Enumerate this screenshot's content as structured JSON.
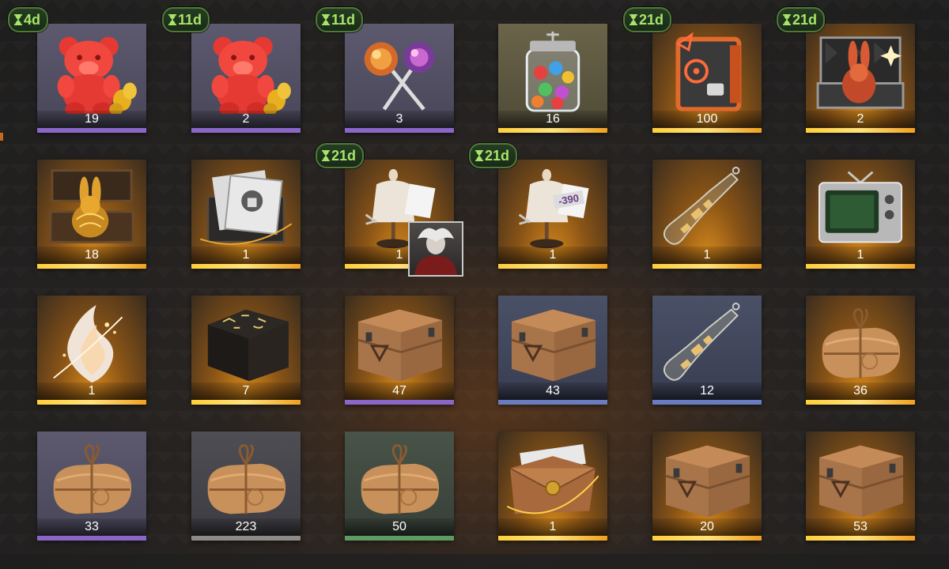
{
  "colors": {
    "rarity_purple": "#8a66c8",
    "rarity_gold": "#ffd24a",
    "rarity_blue": "#6a7cc0",
    "rarity_green": "#5f9a62",
    "rarity_grey": "#8e8b86",
    "timer_text": "#a6e56a"
  },
  "inventory": {
    "items": [
      {
        "icon": "red-gummy-bear-icon",
        "quantity": "19",
        "timer": "4d",
        "rarity": "purple"
      },
      {
        "icon": "red-gummy-bear-icon",
        "quantity": "2",
        "timer": "11d",
        "rarity": "purple"
      },
      {
        "icon": "lollipops-icon",
        "quantity": "3",
        "timer": "11d",
        "rarity": "purple"
      },
      {
        "icon": "candy-jar-icon",
        "quantity": "16",
        "timer": "",
        "rarity": "gold"
      },
      {
        "icon": "rune-cassette-book-icon",
        "quantity": "100",
        "timer": "21d",
        "rarity": "gold"
      },
      {
        "icon": "rabbit-figure-case-icon",
        "quantity": "2",
        "timer": "21d",
        "rarity": "gold"
      },
      {
        "icon": "golden-rabbit-box-icon",
        "quantity": "18",
        "timer": "",
        "rarity": "gold"
      },
      {
        "icon": "photo-box-icon",
        "quantity": "1",
        "timer": "",
        "rarity": "gold"
      },
      {
        "icon": "tailor-mannequin-icon",
        "quantity": "1",
        "timer": "21d",
        "rarity": "gold"
      },
      {
        "icon": "tailor-mannequin-icon",
        "quantity": "1",
        "timer": "21d",
        "rarity": "gold",
        "tag": "-390"
      },
      {
        "icon": "message-bottle-icon",
        "quantity": "1",
        "timer": "",
        "rarity": "gold"
      },
      {
        "icon": "retro-tv-icon",
        "quantity": "1",
        "timer": "",
        "rarity": "gold"
      },
      {
        "icon": "flame-essence-icon",
        "quantity": "1",
        "timer": "",
        "rarity": "gold"
      },
      {
        "icon": "rune-table-icon",
        "quantity": "7",
        "timer": "",
        "rarity": "gold"
      },
      {
        "icon": "wooden-crate-icon",
        "quantity": "47",
        "timer": "",
        "rarity": "purple"
      },
      {
        "icon": "wooden-crate-icon",
        "quantity": "43",
        "timer": "",
        "rarity": "blue"
      },
      {
        "icon": "message-bottle-icon",
        "quantity": "12",
        "timer": "",
        "rarity": "blue"
      },
      {
        "icon": "wrapped-parcel-icon",
        "quantity": "36",
        "timer": "",
        "rarity": "gold"
      },
      {
        "icon": "wrapped-parcel-icon",
        "quantity": "33",
        "timer": "",
        "rarity": "purple"
      },
      {
        "icon": "wrapped-parcel-icon",
        "quantity": "223",
        "timer": "",
        "rarity": "grey"
      },
      {
        "icon": "wrapped-parcel-icon",
        "quantity": "50",
        "timer": "",
        "rarity": "green"
      },
      {
        "icon": "sealed-envelope-icon",
        "quantity": "1",
        "timer": "",
        "rarity": "gold"
      },
      {
        "icon": "wooden-crate-icon",
        "quantity": "20",
        "timer": "",
        "rarity": "gold"
      },
      {
        "icon": "wooden-crate-icon",
        "quantity": "53",
        "timer": "",
        "rarity": "gold"
      }
    ]
  }
}
